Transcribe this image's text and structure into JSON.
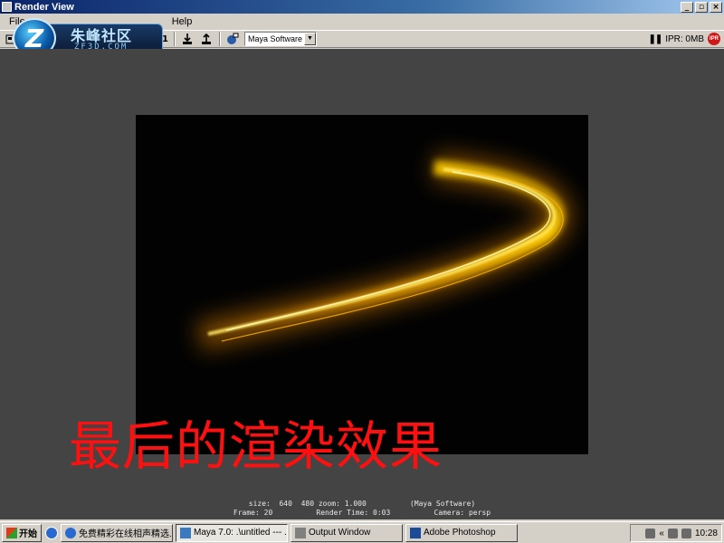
{
  "window": {
    "title": "Render View",
    "minimize_label": "_",
    "maximize_label": "▫",
    "close_label": "×"
  },
  "menu": {
    "items": [
      "File",
      "Help"
    ]
  },
  "toolbar": {
    "zoom_label": "1:1",
    "renderer_value": "Maya Software",
    "ipr_label": "IPR: 0MB",
    "ipr_badge": "IPR"
  },
  "watermark": {
    "logo_letter": "Z",
    "name_cn": "朱峰社区",
    "name_en": "ZF3D.COM"
  },
  "render": {
    "overlay_text": "最后的渲染效果",
    "info_line1": "size:  640  480 zoom: 1.000          (Maya Software)",
    "info_line2": "Frame: 20          Render Time: 0:03          Camera: persp",
    "glow_color": "#ffcc00"
  },
  "taskbar": {
    "start_label": "开始",
    "tasks": [
      {
        "label": "免费精彩在线相声精选..."
      },
      {
        "label": "Maya 7.0: .\\untitled  --- ..."
      },
      {
        "label": "Output Window"
      },
      {
        "label": "Adobe Photoshop"
      }
    ],
    "clock": "10:28",
    "tray_arrow": "«"
  }
}
